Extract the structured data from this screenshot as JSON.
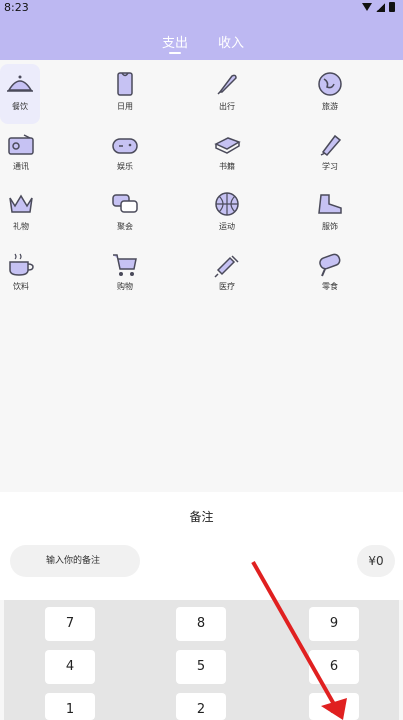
{
  "status_bar": {
    "time": "8:23"
  },
  "header": {
    "tabs": [
      {
        "label": "支出"
      },
      {
        "label": "收入"
      }
    ]
  },
  "categories": [
    {
      "label": "餐饮",
      "icon": "cloche-icon"
    },
    {
      "label": "日用",
      "icon": "tissue-icon"
    },
    {
      "label": "出行",
      "icon": "rocket-icon"
    },
    {
      "label": "旅游",
      "icon": "globe-icon"
    },
    {
      "label": "通讯",
      "icon": "radio-icon"
    },
    {
      "label": "娱乐",
      "icon": "gamepad-icon"
    },
    {
      "label": "书籍",
      "icon": "book-icon"
    },
    {
      "label": "学习",
      "icon": "pen-icon"
    },
    {
      "label": "礼物",
      "icon": "crown-icon"
    },
    {
      "label": "聚会",
      "icon": "chat-icon"
    },
    {
      "label": "运动",
      "icon": "ball-icon"
    },
    {
      "label": "服饰",
      "icon": "shoe-icon"
    },
    {
      "label": "饮料",
      "icon": "cup-icon"
    },
    {
      "label": "购物",
      "icon": "cart-icon"
    },
    {
      "label": "医疗",
      "icon": "syringe-icon"
    },
    {
      "label": "零食",
      "icon": "popsicle-icon"
    }
  ],
  "memo": {
    "title": "备注",
    "placeholder": "输入你的备注",
    "amount": "¥0"
  },
  "keypad": {
    "keys": [
      "7",
      "8",
      "9",
      "4",
      "5",
      "6",
      "1",
      "2",
      "3"
    ]
  },
  "colors": {
    "accent": "#bdb8f2",
    "icon_fill": "#c6c2f3",
    "icon_stroke": "#4a4a5a"
  }
}
